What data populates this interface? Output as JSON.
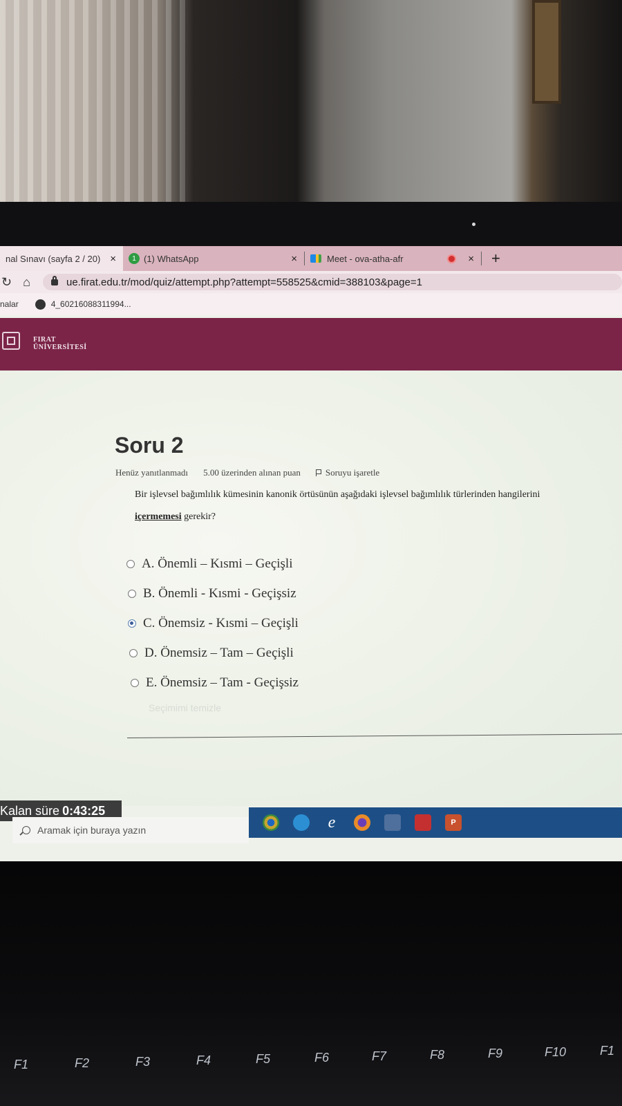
{
  "browser": {
    "tabs": [
      {
        "label": "nal Sınavı (sayfa 2 / 20)",
        "active": true
      },
      {
        "label": "(1) WhatsApp",
        "badge": "1"
      },
      {
        "label": "Meet - ova-atha-afr"
      }
    ],
    "close_glyph": "×",
    "new_tab_glyph": "+",
    "url": "ue.firat.edu.tr/mod/quiz/attempt.php?attempt=558525&cmid=388103&page=1",
    "bookmarks_label": "nalar",
    "bookmark_item": "4_60216088311994..."
  },
  "site": {
    "logo_line1": "FIRAT",
    "logo_line2": "ÜNİVERSİTESİ"
  },
  "question": {
    "title": "Soru 2",
    "status": "Henüz yanıtlanmadı",
    "points": "5.00 üzerinden alınan puan",
    "flag_label": "Soruyu işaretle",
    "text_part1": "Bir işlevsel bağımlılık kümesinin kanonik örtüsünün aşağıdaki işlevsel bağımlılık türlerinden hangilerini ",
    "text_emphasis": "içermemesi",
    "text_part2": " gerekir?",
    "answers": [
      {
        "label": "A. Önemli – Kısmi – Geçişli",
        "selected": false
      },
      {
        "label": "B. Önemli - Kısmi - Geçişsiz",
        "selected": false
      },
      {
        "label": "C. Önemsiz - Kısmi – Geçişli",
        "selected": true
      },
      {
        "label": "D. Önemsiz – Tam – Geçişli",
        "selected": false
      },
      {
        "label": "E. Önemsiz – Tam - Geçişsiz",
        "selected": false
      }
    ],
    "clear_choice": "Seçimimi temizle"
  },
  "timer": {
    "label": "Kalan süre",
    "value": "0:43:25"
  },
  "taskbar": {
    "search_placeholder": "Aramak için buraya yazın",
    "apps": [
      "chrome-icon",
      "edge-icon",
      "internet-explorer-icon",
      "firefox-icon",
      "camera-icon",
      "game-icon",
      "powerpoint-icon"
    ],
    "ppt_glyph": "P"
  },
  "keyboard": {
    "fkeys": [
      "F1",
      "F2",
      "F3",
      "F4",
      "F5",
      "F6",
      "F7",
      "F8",
      "F9",
      "F10",
      "F1"
    ]
  },
  "colors": {
    "site_header": "#7b2448",
    "tab_strip": "#d9b3bd",
    "taskbar": "#1d4f86"
  }
}
